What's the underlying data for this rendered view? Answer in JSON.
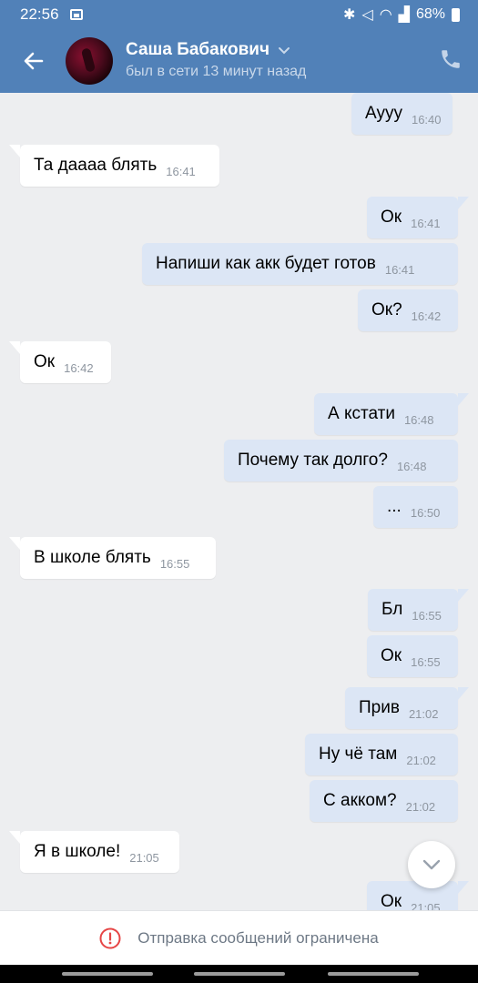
{
  "status_bar": {
    "time": "22:56",
    "battery": "68%"
  },
  "header": {
    "name": "Саша Бабакович",
    "status": "был в сети 13 минут назад"
  },
  "messages": [
    {
      "dir": "out",
      "text": "Аууу",
      "time": "16:40"
    },
    {
      "dir": "in",
      "text": "Та даааа блять",
      "time": "16:41"
    },
    {
      "dir": "out",
      "text": "Ок",
      "time": "16:41"
    },
    {
      "dir": "out",
      "text": "Напиши как акк будет готов",
      "time": "16:41"
    },
    {
      "dir": "out",
      "text": "Ок?",
      "time": "16:42"
    },
    {
      "dir": "in",
      "text": "Ок",
      "time": "16:42"
    },
    {
      "dir": "out",
      "text": "А кстати",
      "time": "16:48"
    },
    {
      "dir": "out",
      "text": "Почему так долго?",
      "time": "16:48"
    },
    {
      "dir": "out",
      "text": "...",
      "time": "16:50"
    },
    {
      "dir": "in",
      "text": "В школе блять",
      "time": "16:55"
    },
    {
      "dir": "out",
      "text": "Бл",
      "time": "16:55"
    },
    {
      "dir": "out",
      "text": "Ок",
      "time": "16:55"
    },
    {
      "dir": "out",
      "text": "Прив",
      "time": "21:02"
    },
    {
      "dir": "out",
      "text": "Ну чё там",
      "time": "21:02"
    },
    {
      "dir": "out",
      "text": "С акком?",
      "time": "21:02"
    },
    {
      "dir": "in",
      "text": "Я в школе!",
      "time": "21:05"
    },
    {
      "dir": "out",
      "text": "Ок",
      "time": "21:05"
    }
  ],
  "footer": {
    "notice": "Отправка сообщений ограничена"
  },
  "colors": {
    "header_bg": "#5181b8",
    "chat_bg": "#edeef0",
    "outgoing_bubble": "#dce6f5",
    "incoming_bubble": "#ffffff",
    "warning": "#e64646"
  },
  "icons": [
    "back-arrow-icon",
    "chevron-down-icon",
    "phone-icon",
    "scroll-down-icon",
    "warning-icon"
  ]
}
